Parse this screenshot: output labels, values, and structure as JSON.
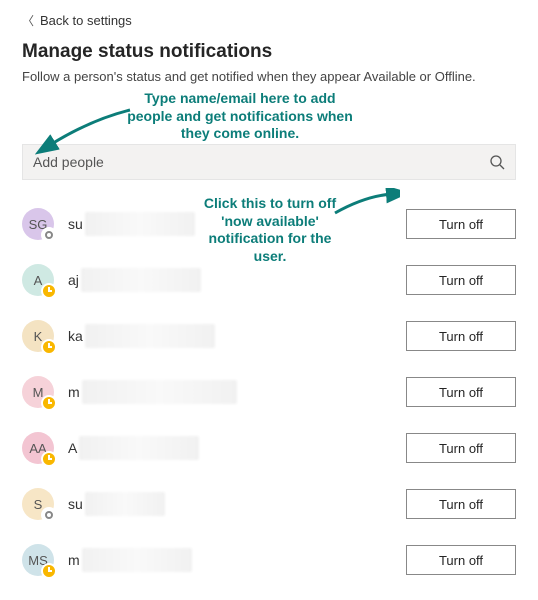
{
  "back_label": "Back to settings",
  "title": "Manage status notifications",
  "subtitle": "Follow a person's status and get notified when they appear Available or Offline.",
  "search": {
    "placeholder": "Add people"
  },
  "turn_off_label": "Turn off",
  "annotations": {
    "add_people": "Type name/email here to add people and get notifications when they come online.",
    "turn_off": "Click this to turn off 'now available' notification for the user."
  },
  "people": [
    {
      "initials": "SG",
      "color": "#d9c6ea",
      "presence": "offline",
      "name_prefix": "su",
      "blur_w": 110
    },
    {
      "initials": "A",
      "color": "#cfe9e3",
      "presence": "away",
      "name_prefix": "aj",
      "blur_w": 120
    },
    {
      "initials": "K",
      "color": "#f4e3c2",
      "presence": "away",
      "name_prefix": "ka",
      "blur_w": 130
    },
    {
      "initials": "M",
      "color": "#f6d2d9",
      "presence": "away",
      "name_prefix": "m",
      "blur_w": 155
    },
    {
      "initials": "AA",
      "color": "#f3c5d2",
      "presence": "away",
      "name_prefix": "A",
      "blur_w": 120
    },
    {
      "initials": "S",
      "color": "#f7e6c6",
      "presence": "offline",
      "name_prefix": "su",
      "blur_w": 80
    },
    {
      "initials": "MS",
      "color": "#cfe3e9",
      "presence": "away",
      "name_prefix": "m",
      "blur_w": 110
    }
  ]
}
